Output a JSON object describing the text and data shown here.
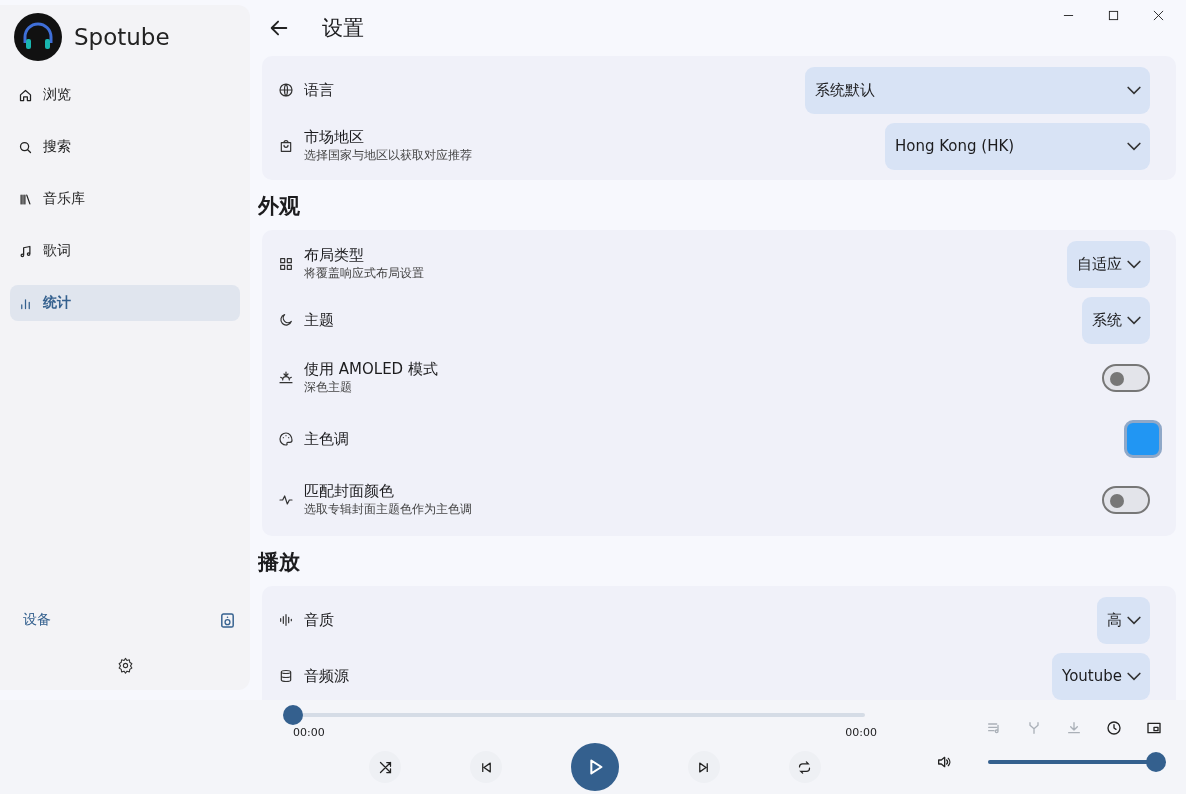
{
  "app": {
    "name": "Spotube"
  },
  "sidebar": {
    "items": [
      {
        "label": "浏览",
        "selected": false
      },
      {
        "label": "搜索",
        "selected": false
      },
      {
        "label": "音乐库",
        "selected": false
      },
      {
        "label": "歌词",
        "selected": false
      },
      {
        "label": "统计",
        "selected": true
      }
    ],
    "devices_label": "设备"
  },
  "page": {
    "title": "设置"
  },
  "sections": [
    {
      "rows": [
        {
          "kind": "dropdown",
          "label": "语言",
          "value": "系统默认"
        },
        {
          "kind": "dropdown",
          "label": "市场地区",
          "sublabel": "选择国家与地区以获取对应推荐",
          "value": "Hong Kong (HK)"
        }
      ]
    },
    {
      "title": "外观",
      "rows": [
        {
          "kind": "dropdown",
          "label": "布局类型",
          "sublabel": "将覆盖响应式布局设置",
          "value": "自适应"
        },
        {
          "kind": "dropdown",
          "label": "主题",
          "value": "系统"
        },
        {
          "kind": "toggle",
          "label": "使用 AMOLED 模式",
          "sublabel": "深色主题",
          "on": false
        },
        {
          "kind": "color",
          "label": "主色调",
          "color": "#2196f3"
        },
        {
          "kind": "toggle",
          "label": "匹配封面颜色",
          "sublabel": "选取专辑封面主题色作为主色调",
          "on": false
        }
      ]
    },
    {
      "title": "播放",
      "rows": [
        {
          "kind": "dropdown",
          "label": "音质",
          "value": "高"
        },
        {
          "kind": "dropdown",
          "label": "音频源",
          "value": "Youtube"
        }
      ]
    }
  ],
  "player": {
    "position": "00:00",
    "duration": "00:00",
    "progress": {
      "level": 0
    },
    "volume": {
      "level": 1
    },
    "actions": [
      {
        "disabled": true
      },
      {
        "disabled": true
      },
      {
        "disabled": true
      },
      {
        "disabled": false
      },
      {
        "disabled": false
      }
    ]
  }
}
